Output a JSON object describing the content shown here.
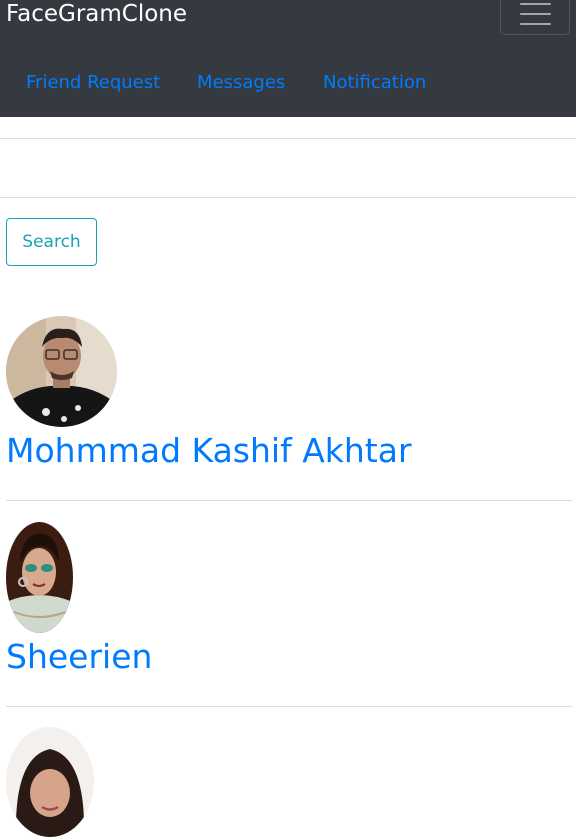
{
  "navbar": {
    "brand": "FaceGramClone",
    "toggler_icon": "hamburger-menu-icon",
    "links": [
      {
        "label": "Friend Request"
      },
      {
        "label": "Messages"
      },
      {
        "label": "Notification"
      }
    ]
  },
  "search": {
    "button_label": "Search"
  },
  "users": [
    {
      "name": "Mohmmad Kashif Akhtar"
    },
    {
      "name": "Sheerien"
    },
    {
      "name": ""
    }
  ],
  "colors": {
    "navbar_bg": "#343a40",
    "link": "#007bff",
    "search_outline": "#17a2b8"
  }
}
